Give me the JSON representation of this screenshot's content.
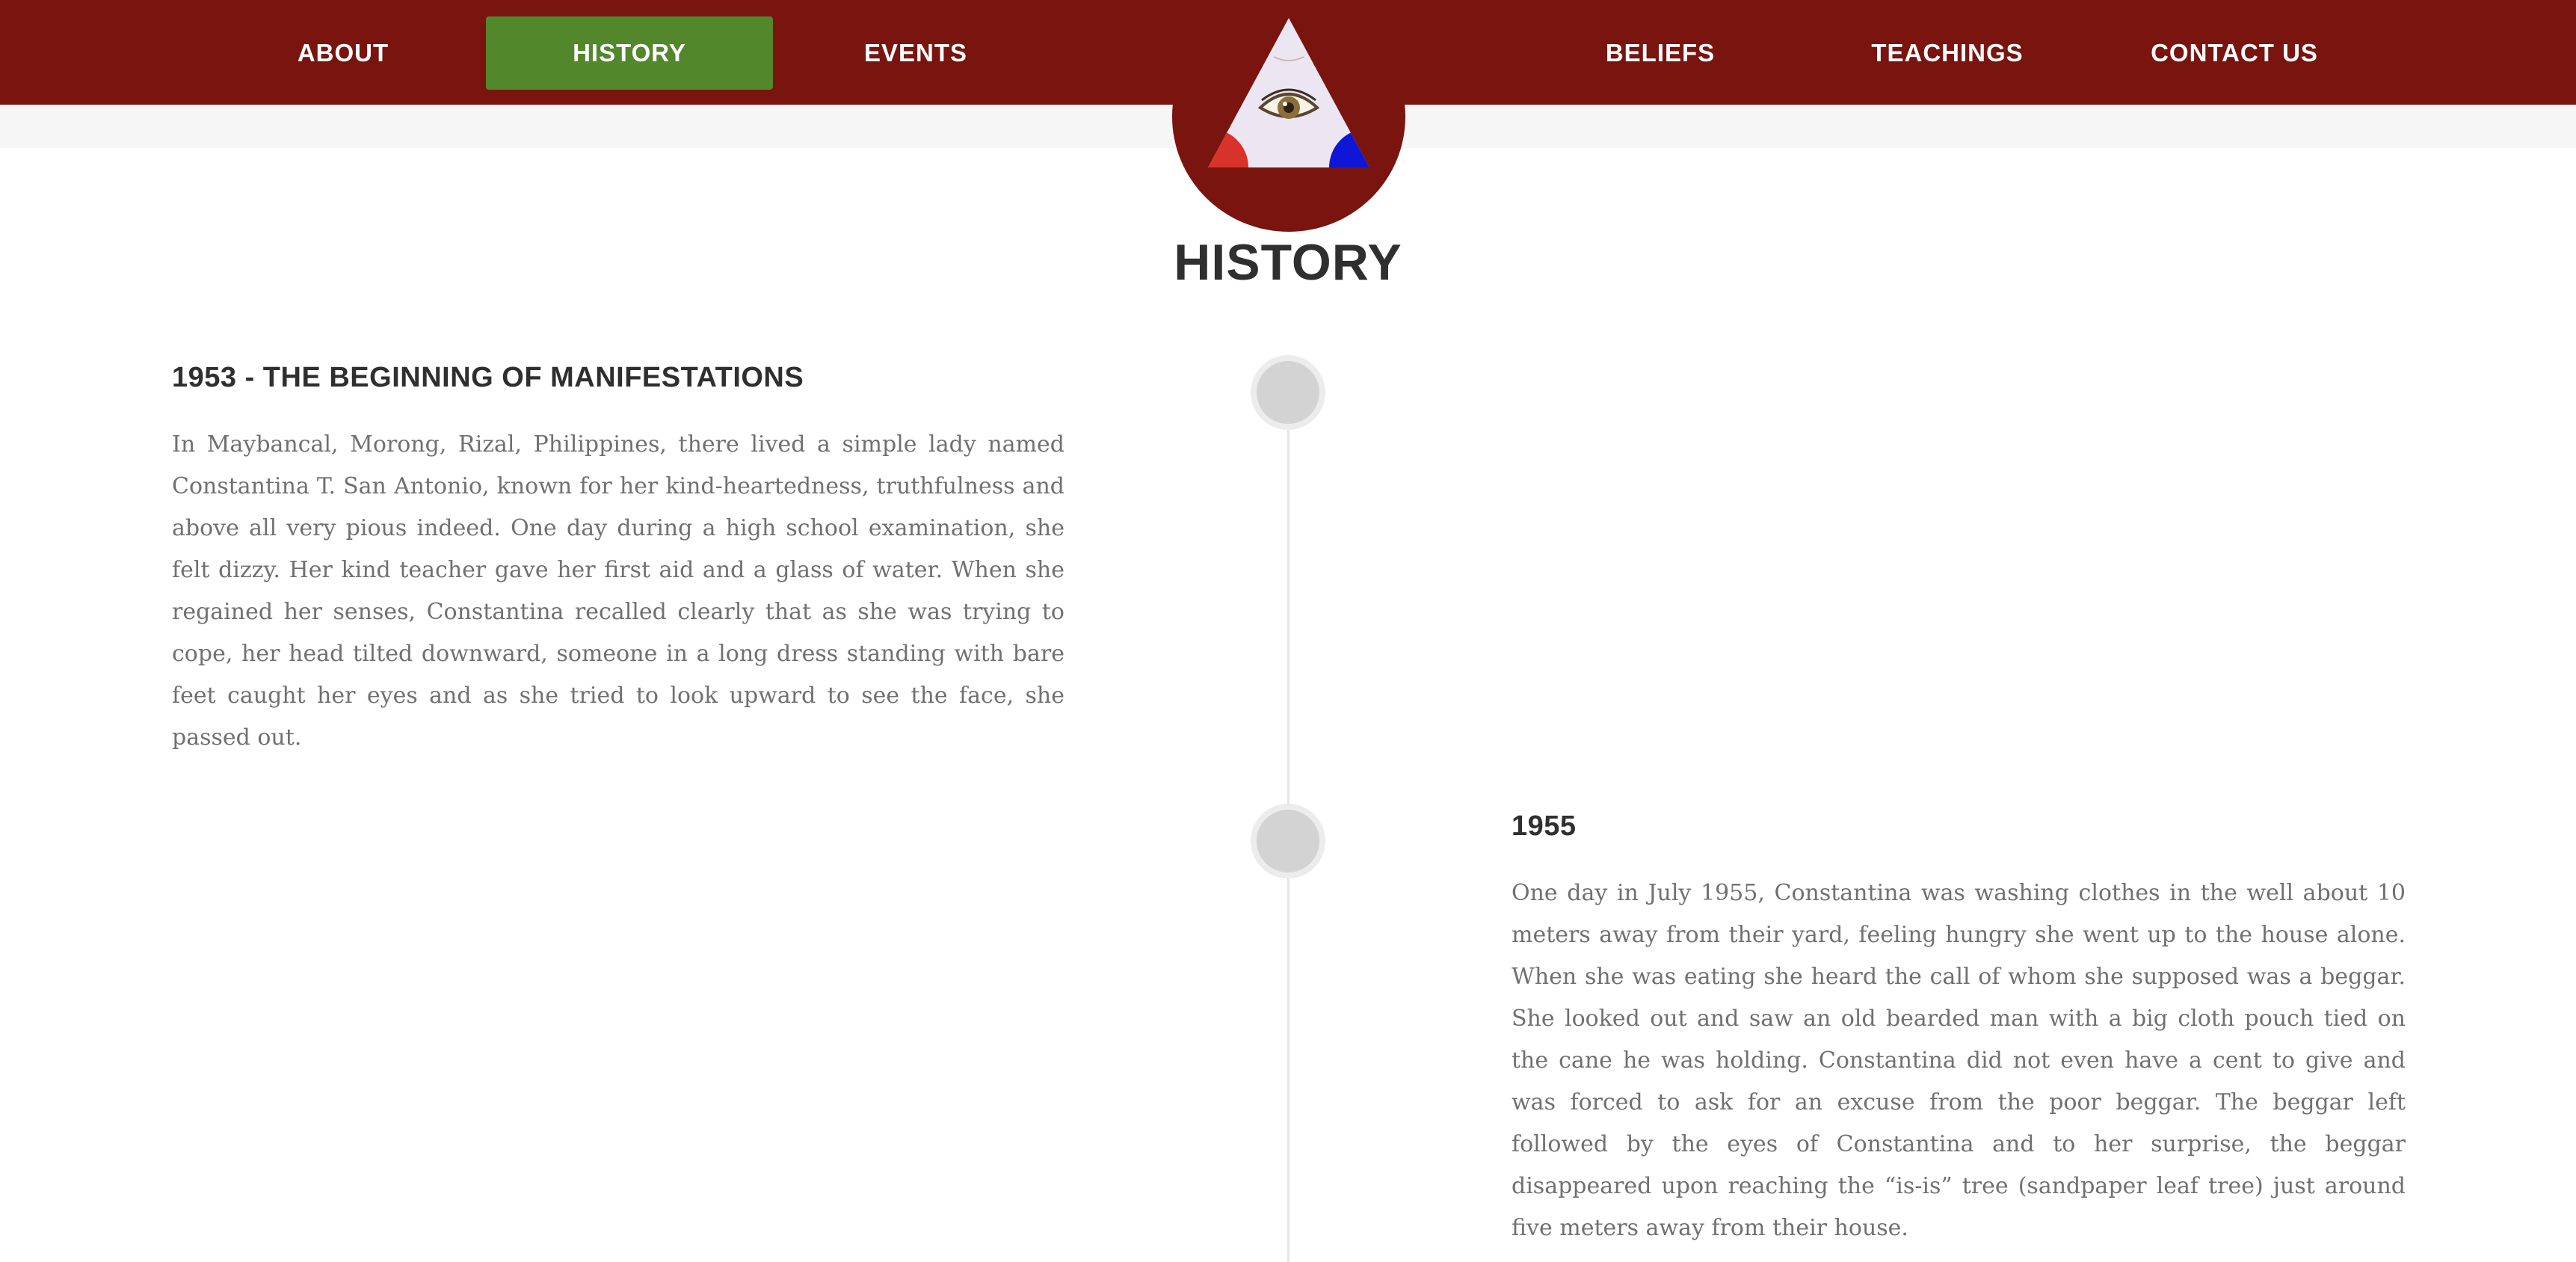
{
  "nav": {
    "items": [
      {
        "label": "ABOUT",
        "active": false
      },
      {
        "label": "HISTORY",
        "active": true
      },
      {
        "label": "EVENTS",
        "active": false
      },
      {
        "label": "BELIEFS",
        "active": false
      },
      {
        "label": "TEACHINGS",
        "active": false
      },
      {
        "label": "CONTACT US",
        "active": false
      }
    ],
    "logo_icon": "all-seeing-eye-triangle-icon"
  },
  "page": {
    "title": "HISTORY"
  },
  "timeline": [
    {
      "heading": "1953 - THE BEGINNING OF MANIFESTATIONS",
      "side": "left",
      "text": "In Maybancal, Morong, Rizal, Philippines, there lived a simple lady named Constantina T. San Antonio, known for her kind-heartedness, truthfulness and above all very pious indeed. One day during a high school examination, she felt dizzy. Her kind teacher gave her first aid and a glass of water. When she regained her senses, Constantina recalled clearly that as she was trying to cope, her head tilted downward, someone in a long dress standing with bare feet caught her eyes and as she tried to look upward to see the face, she passed out."
    },
    {
      "heading": "1955",
      "side": "right",
      "text": "One day in July 1955, Constantina was washing clothes in the well about 10 meters away from their yard, feeling hungry she went up to the house alone. When she was eating she heard the call of whom she supposed was a beggar. She looked out and saw an old bearded man with a big cloth pouch tied on the cane he was holding. Constantina did not even have a cent to give and was forced to ask for an excuse from the poor beggar. The beggar left followed by the eyes of Constantina and to her surprise, the beggar disappeared upon reaching the “is-is” tree (sandpaper leaf tree) just around five meters away from their house."
    }
  ],
  "colors": {
    "header_bg": "#79140f",
    "active_nav_bg": "#52872c",
    "heading_text": "#2f2f2f",
    "body_text": "#707070",
    "timeline_dot": "#d3d3d3"
  }
}
